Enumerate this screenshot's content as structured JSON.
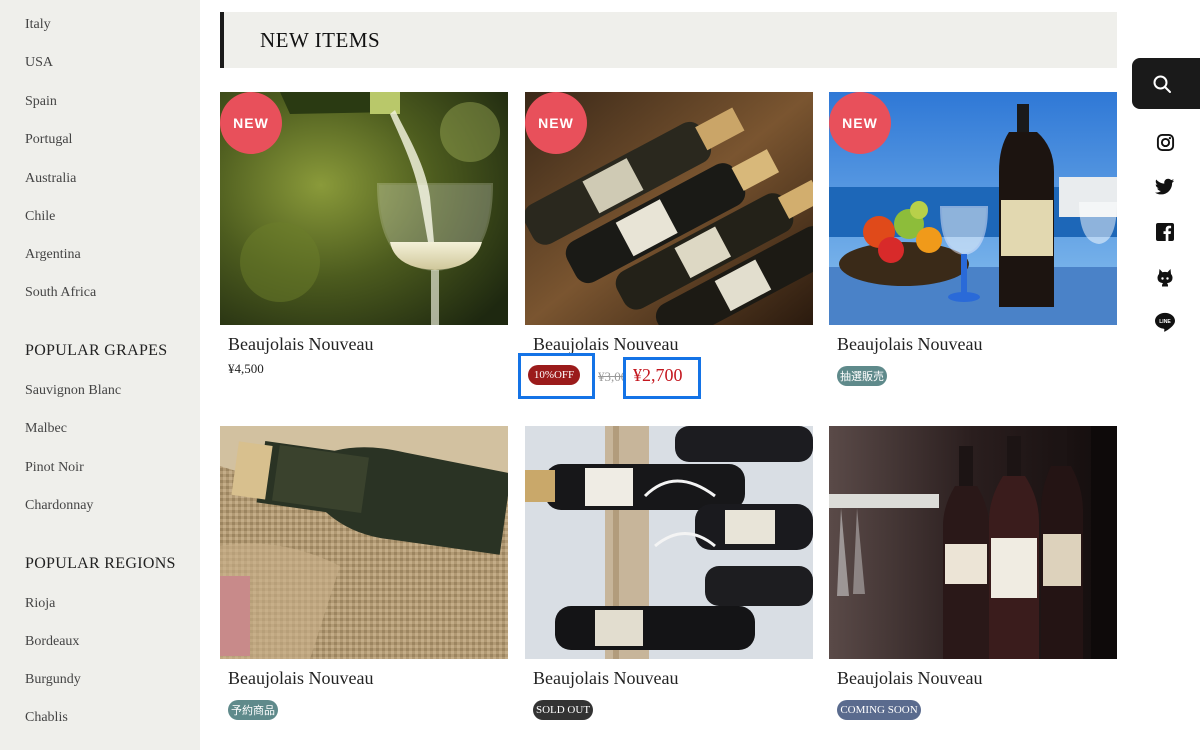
{
  "sidebar": {
    "countries": [
      "Italy",
      "USA",
      "Spain",
      "Portugal",
      "Australia",
      "Chile",
      "Argentina",
      "South Africa"
    ],
    "grapes_heading": "POPULAR GRAPES",
    "grapes": [
      "Sauvignon Blanc",
      "Malbec",
      "Pinot Noir",
      "Chardonnay"
    ],
    "regions_heading": "POPULAR REGIONS",
    "regions": [
      "Rioja",
      "Bordeaux",
      "Burgundy",
      "Chablis"
    ]
  },
  "section": {
    "title": "NEW ITEMS"
  },
  "badges": {
    "new": "NEW"
  },
  "products": [
    {
      "name": "Beaujolais Nouveau",
      "price": "¥4,500",
      "image": "white-wine-pour"
    },
    {
      "name": "Beaujolais Nouveau",
      "discount": "10%OFF",
      "original_price": "¥3,000",
      "sale_price": "¥2,700",
      "image": "bottles-in-rack"
    },
    {
      "name": "Beaujolais Nouveau",
      "tag": "抽選販売",
      "image": "port-bottle-seaside"
    },
    {
      "name": "Beaujolais Nouveau",
      "tag": "予約商品",
      "image": "bottle-on-burlap"
    },
    {
      "name": "Beaujolais Nouveau",
      "tag": "SOLD OUT",
      "image": "wall-wine-rack"
    },
    {
      "name": "Beaujolais Nouveau",
      "tag": "COMING SOON",
      "image": "bottles-on-bar"
    }
  ],
  "right_rail": {
    "icons": [
      "search-icon",
      "instagram-icon",
      "twitter-icon",
      "facebook-icon",
      "github-icon",
      "line-icon"
    ]
  },
  "colors": {
    "new_badge": "#e8505b",
    "discount_badge": "#9b1b1b",
    "sale_price": "#c4171f",
    "highlight": "#1473e6",
    "tag_teal": "#5f8a8b",
    "tag_dark": "#333333",
    "tag_slate": "#5a6b8e"
  }
}
